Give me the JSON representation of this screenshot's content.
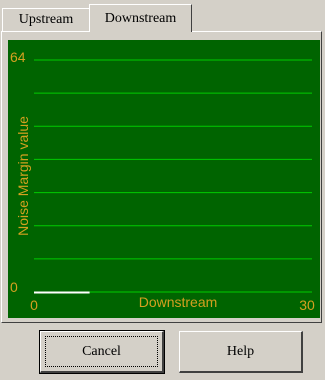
{
  "tabs": [
    {
      "label": "Upstream",
      "selected": false
    },
    {
      "label": "Downstream",
      "selected": true
    }
  ],
  "buttons": {
    "cancel_label": "Cancel",
    "help_label": "Help"
  },
  "colors": {
    "chart_background": "#006400",
    "grid_line": "#00cc00",
    "axis_text": "#d4a020",
    "data_line": "#ffffff"
  },
  "chart_data": {
    "type": "line",
    "xlabel": "Downstream",
    "ylabel": "Noise Margin value",
    "xlim": [
      0,
      30
    ],
    "ylim": [
      0,
      64
    ],
    "x_tick_labels": [
      "0",
      "30"
    ],
    "y_tick_labels": [
      "64",
      "0"
    ],
    "grid": true,
    "grid_y_values": [
      0,
      9.14,
      18.29,
      27.43,
      36.57,
      45.71,
      54.86,
      64
    ],
    "series": [
      {
        "x": [
          0,
          6
        ],
        "y": [
          0,
          0
        ]
      }
    ]
  }
}
